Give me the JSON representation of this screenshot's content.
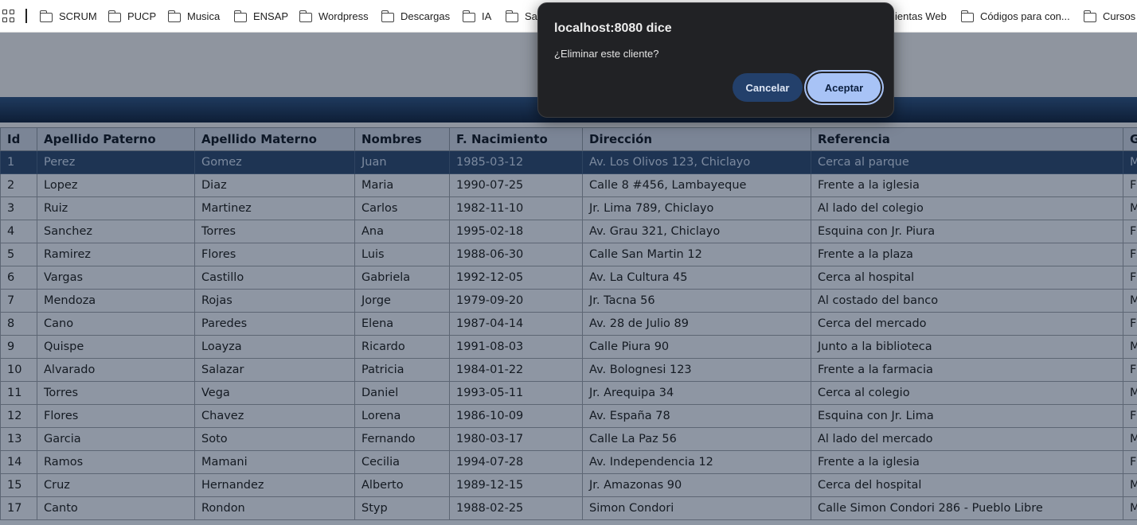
{
  "bookmarks": [
    "SCRUM",
    "PUCP",
    "Musica",
    "ENSAP",
    "Wordpress",
    "Descargas",
    "IA",
    "Sa",
    "ientas Web",
    "Códigos para con...",
    "Cursos"
  ],
  "dialog": {
    "title": "localhost:8080 dice",
    "message": "¿Eliminar este cliente?",
    "cancel_label": "Cancelar",
    "ok_label": "Aceptar"
  },
  "table": {
    "headers": [
      "Id",
      "Apellido Paterno",
      "Apellido Materno",
      "Nombres",
      "F. Nacimiento",
      "Dirección",
      "Referencia",
      "G"
    ],
    "rows": [
      [
        "1",
        "Perez",
        "Gomez",
        "Juan",
        "1985-03-12",
        "Av. Los Olivos 123, Chiclayo",
        "Cerca al parque",
        "M"
      ],
      [
        "2",
        "Lopez",
        "Diaz",
        "Maria",
        "1990-07-25",
        "Calle 8 #456, Lambayeque",
        "Frente a la iglesia",
        "F"
      ],
      [
        "3",
        "Ruiz",
        "Martinez",
        "Carlos",
        "1982-11-10",
        "Jr. Lima 789, Chiclayo",
        "Al lado del colegio",
        "M"
      ],
      [
        "4",
        "Sanchez",
        "Torres",
        "Ana",
        "1995-02-18",
        "Av. Grau 321, Chiclayo",
        "Esquina con Jr. Piura",
        "F"
      ],
      [
        "5",
        "Ramirez",
        "Flores",
        "Luis",
        "1988-06-30",
        "Calle San Martin 12",
        "Frente a la plaza",
        "F"
      ],
      [
        "6",
        "Vargas",
        "Castillo",
        "Gabriela",
        "1992-12-05",
        "Av. La Cultura 45",
        "Cerca al hospital",
        "F"
      ],
      [
        "7",
        "Mendoza",
        "Rojas",
        "Jorge",
        "1979-09-20",
        "Jr. Tacna 56",
        "Al costado del banco",
        "M"
      ],
      [
        "8",
        "Cano",
        "Paredes",
        "Elena",
        "1987-04-14",
        "Av. 28 de Julio 89",
        "Cerca del mercado",
        "F"
      ],
      [
        "9",
        "Quispe",
        "Loayza",
        "Ricardo",
        "1991-08-03",
        "Calle Piura 90",
        "Junto a la biblioteca",
        "M"
      ],
      [
        "10",
        "Alvarado",
        "Salazar",
        "Patricia",
        "1984-01-22",
        "Av. Bolognesi 123",
        "Frente a la farmacia",
        "F"
      ],
      [
        "11",
        "Torres",
        "Vega",
        "Daniel",
        "1993-05-11",
        "Jr. Arequipa 34",
        "Cerca al colegio",
        "M"
      ],
      [
        "12",
        "Flores",
        "Chavez",
        "Lorena",
        "1986-10-09",
        "Av. España 78",
        "Esquina con Jr. Lima",
        "F"
      ],
      [
        "13",
        "Garcia",
        "Soto",
        "Fernando",
        "1980-03-17",
        "Calle La Paz 56",
        "Al lado del mercado",
        "M"
      ],
      [
        "14",
        "Ramos",
        "Mamani",
        "Cecilia",
        "1994-07-28",
        "Av. Independencia 12",
        "Frente a la iglesia",
        "F"
      ],
      [
        "15",
        "Cruz",
        "Hernandez",
        "Alberto",
        "1989-12-15",
        "Jr. Amazonas 90",
        "Cerca del hospital",
        "M"
      ],
      [
        "17",
        "Canto",
        "Rondon",
        "Styp",
        "1988-02-25",
        "Simon Condori",
        "Calle Simon Condori 286 - Pueblo Libre",
        "M"
      ]
    ]
  }
}
